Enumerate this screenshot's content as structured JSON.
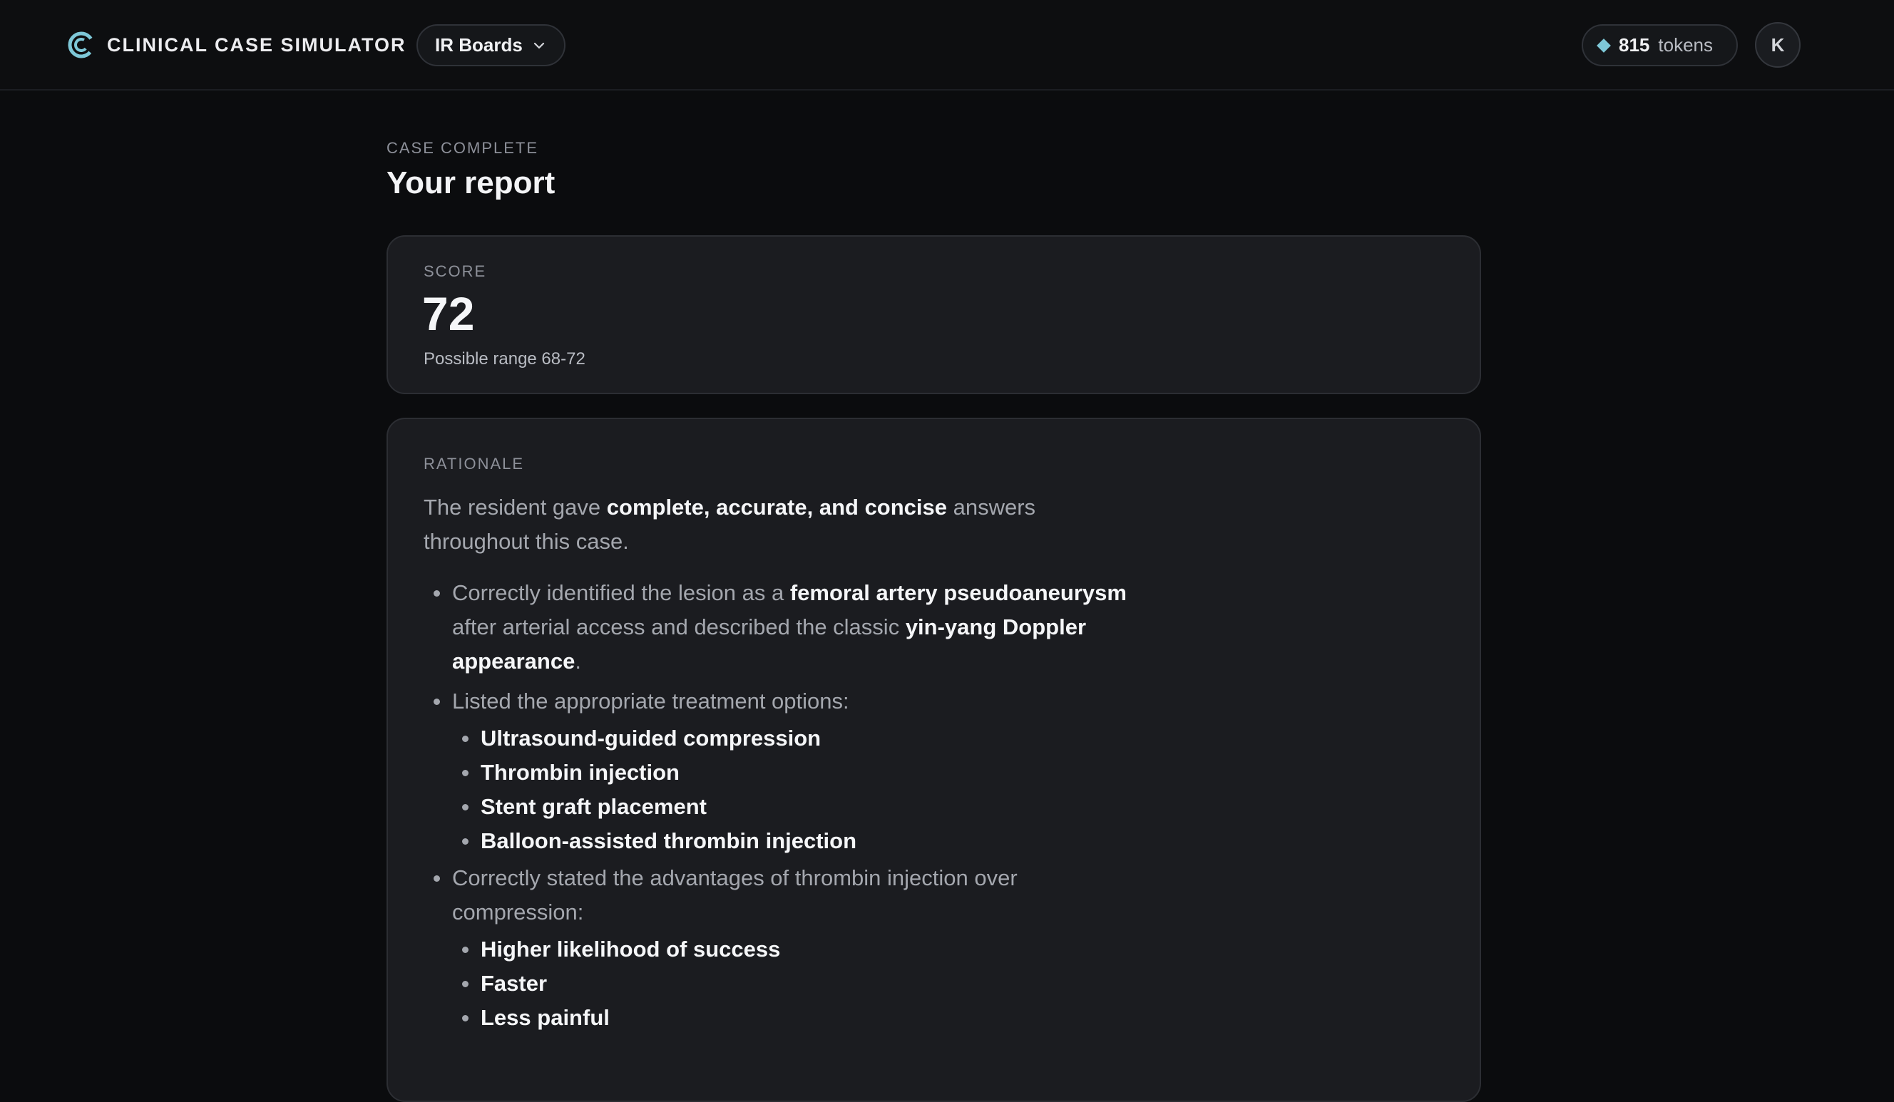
{
  "header": {
    "brand_name": "CLINICAL CASE SIMULATOR",
    "brand_icon": "c-logo-icon",
    "selector_label": "IR Boards",
    "tokens_count": "815",
    "tokens_unit": "tokens",
    "avatar_initial": "K",
    "accent_color": "#7ec8d8"
  },
  "page": {
    "eyebrow": "CASE COMPLETE",
    "title": "Your report"
  },
  "score": {
    "label": "SCORE",
    "value": "72",
    "range_text": "Possible range 68-72"
  },
  "rationale": {
    "label": "RATIONALE",
    "intro": {
      "before": "The resident gave ",
      "bold": "complete, accurate, and concise",
      "after": " answers throughout this case."
    },
    "point1": {
      "t1": "Correctly identified the lesion as a ",
      "b1": "femoral artery pseudoaneurysm",
      "t2": " after arterial access and described the classic ",
      "b2": "yin-yang Doppler appearance",
      "t3": "."
    },
    "point2": {
      "text": "Listed the appropriate treatment options:",
      "items": [
        "Ultrasound-guided compression",
        "Thrombin injection",
        "Stent graft placement",
        "Balloon-assisted thrombin injection"
      ]
    },
    "point3": {
      "text": "Correctly stated the advantages of thrombin injection over compression:",
      "items": [
        "Higher likelihood of success",
        "Faster",
        "Less painful"
      ]
    }
  }
}
